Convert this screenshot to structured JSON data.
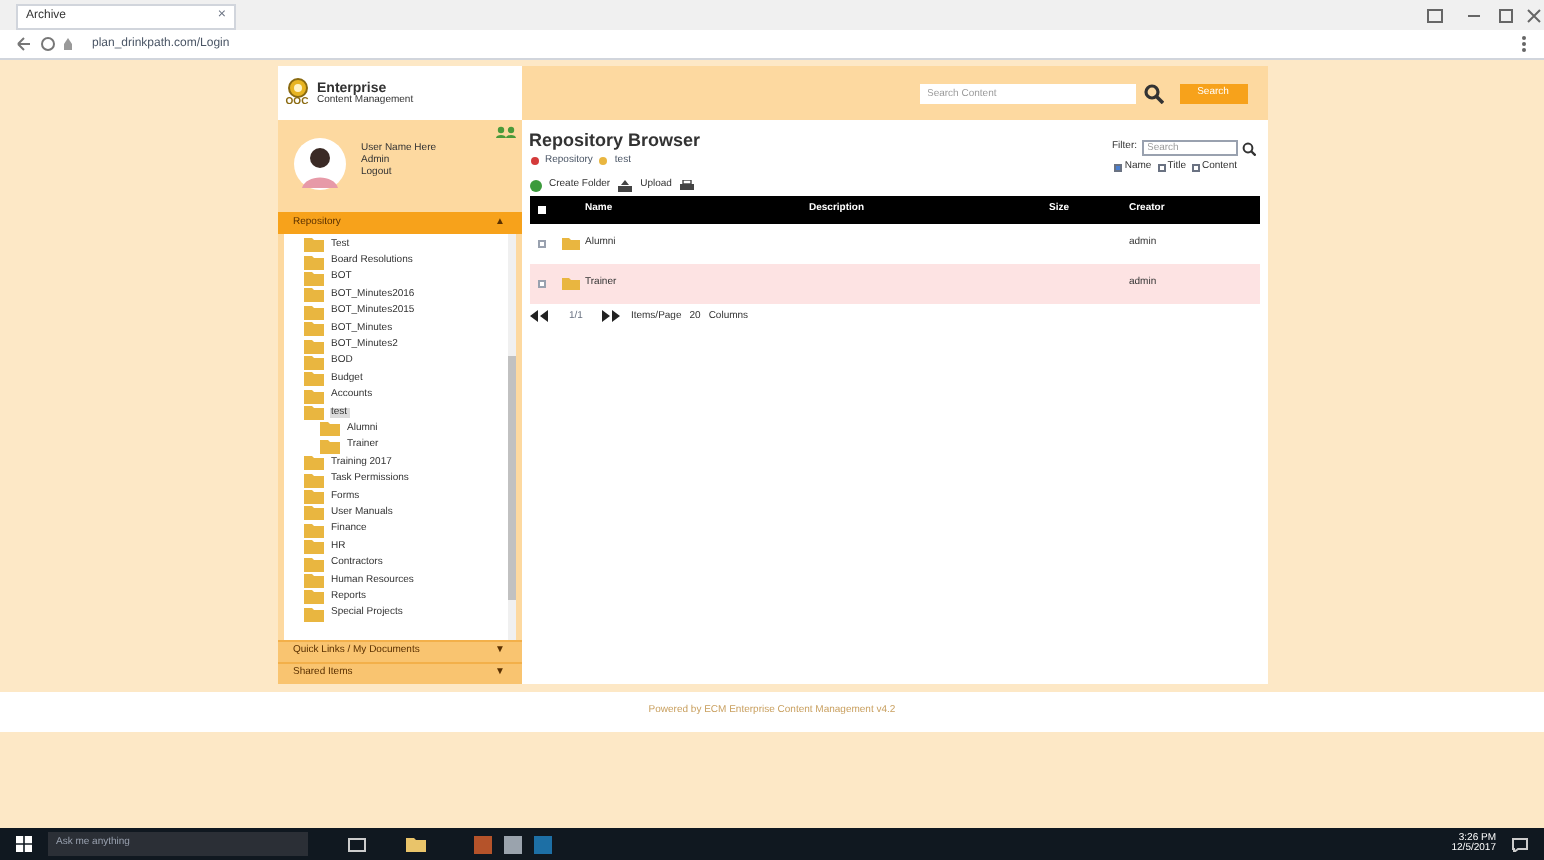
{
  "browser": {
    "tab_title": "Archive",
    "tab_close": "×",
    "address": "plan_drinkpath.com/Login"
  },
  "header": {
    "logo_text": "OOC",
    "brand": "Enterprise",
    "subtitle": "Content Management",
    "search": {
      "placeholder": "Search Content"
    },
    "search_button": "Search"
  },
  "user": {
    "name": "User Name Here",
    "role": "Admin",
    "status": "Logout"
  },
  "sidebar": {
    "sections": [
      {
        "label": "Repository",
        "expanded": true,
        "toggle": "▲"
      },
      {
        "label": "Quick Links / My Documents",
        "expanded": false,
        "toggle": "▼"
      },
      {
        "label": "Shared Items",
        "expanded": false,
        "toggle": "▼"
      }
    ],
    "tree": [
      {
        "label": "Test",
        "selected": false
      },
      {
        "label": "Board Resolutions",
        "selected": false
      },
      {
        "label": "BOT",
        "selected": false
      },
      {
        "label": "BOT_Minutes2016",
        "selected": false
      },
      {
        "label": "BOT_Minutes2015",
        "selected": false
      },
      {
        "label": "BOT_Minutes",
        "selected": false
      },
      {
        "label": "BOT_Minutes2",
        "selected": false
      },
      {
        "label": "BOD",
        "selected": false
      },
      {
        "label": "Budget",
        "selected": false
      },
      {
        "label": "Accounts",
        "selected": false
      },
      {
        "label": "test",
        "selected": true,
        "children": [
          {
            "label": "Alumni",
            "selected": false
          },
          {
            "label": "Trainer",
            "selected": false
          }
        ]
      },
      {
        "label": "Training 2017",
        "selected": false
      },
      {
        "label": "Task Permissions",
        "selected": false
      },
      {
        "label": "Forms",
        "selected": false
      },
      {
        "label": "User Manuals",
        "selected": false
      },
      {
        "label": "Finance",
        "selected": false
      },
      {
        "label": "HR",
        "selected": false
      },
      {
        "label": "Contractors",
        "selected": false
      },
      {
        "label": "Human Resources",
        "selected": false
      },
      {
        "label": "Reports",
        "selected": false
      },
      {
        "label": "Special Projects",
        "selected": false
      }
    ]
  },
  "main": {
    "title": "Repository Browser",
    "breadcrumb": [
      "Repository",
      "test"
    ],
    "filter_label": "Filter:",
    "search": {
      "placeholder": "Search"
    },
    "filter_options": [
      {
        "label": "Name",
        "checked": true
      },
      {
        "label": "Title",
        "checked": false
      },
      {
        "label": "Content",
        "checked": false
      }
    ],
    "actions": [
      "Create Folder",
      "Upload"
    ],
    "table": {
      "select_all_checked": false,
      "columns": [
        "Name",
        "Description",
        "Size",
        "Creator"
      ],
      "rows": [
        {
          "selected": false,
          "checked": false,
          "name": "Alumni",
          "creator": "admin"
        },
        {
          "selected": true,
          "checked": false,
          "name": "Trainer",
          "creator": "admin"
        }
      ]
    },
    "pager": {
      "page": "1/1",
      "page_size": "20",
      "page_size_label": "Items/Page",
      "view": "Columns"
    }
  },
  "footer": "Powered by ECM Enterprise Content Management v4.2",
  "taskbar": {
    "search_placeholder": "Ask me anything",
    "time": "3:26 PM",
    "date": "12/5/2017"
  }
}
